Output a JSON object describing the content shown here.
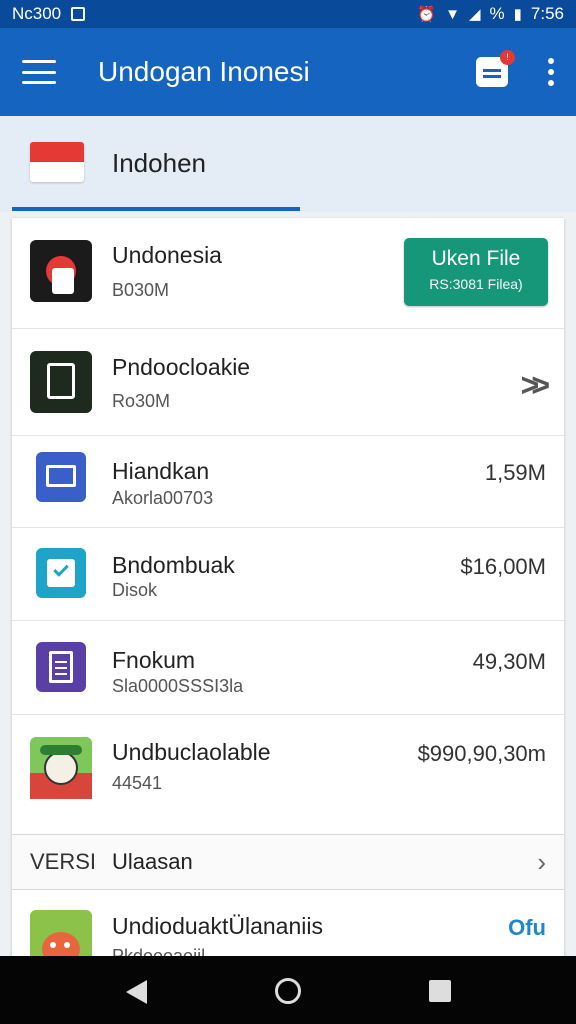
{
  "status_bar": {
    "carrier": "Nc300",
    "battery": "%",
    "time": "7:56"
  },
  "app_bar": {
    "title": "Undogan Inonesi",
    "badge": "!"
  },
  "region_tab": {
    "label": "Indohen"
  },
  "rows": [
    {
      "name": "Undonesia",
      "sub": "B030M",
      "action": {
        "label": "Uken File",
        "sub": "RS:3081 Filea)"
      }
    },
    {
      "name": "Pndoocloakie",
      "sub": "Ro30M",
      "action_icon": "double-chevron-right-icon"
    },
    {
      "name": "Hiandkan",
      "sub": "Akorla00703",
      "value": "1,59M"
    },
    {
      "name": "Bndombuak",
      "sub": "Disok",
      "value": "$16,00M"
    },
    {
      "name": "Fnokum",
      "sub": "Sla0000SSSI3la",
      "value": "49,30M"
    },
    {
      "name": "Undbuclaolable",
      "sub": "44541",
      "value": "$990,90,30m"
    }
  ],
  "section": {
    "prefix": "VERSI",
    "label": "Ulaasan"
  },
  "last_row": {
    "name": "UndioduaktÜlananiis",
    "sub": "Pkdoooaoiil",
    "value": "Ofu"
  },
  "colors": {
    "app_bar": "#1565c0",
    "status_bar": "#0a4a9a",
    "button": "#16977a",
    "link": "#1e88c8"
  }
}
